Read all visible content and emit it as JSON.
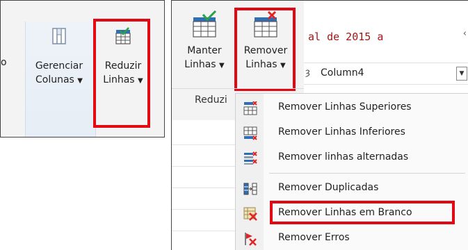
{
  "left": {
    "cut_text": "o",
    "gerenciar": {
      "line1": "Gerenciar",
      "line2": "Colunas"
    },
    "reduzir": {
      "line1": "Reduzir",
      "line2": "Linhas"
    }
  },
  "ribbon": {
    "manter": {
      "line1": "Manter",
      "line2": "Linhas"
    },
    "remover": {
      "line1": "Remover",
      "line2": "Linhas"
    },
    "group_label": "Reduzi"
  },
  "formula_text": "al de 2015 a",
  "formula_right": "‹",
  "column": {
    "type_label": "ȝ",
    "name": "Column4"
  },
  "menu": {
    "items": [
      {
        "label": "Remover Linhas Superiores",
        "icon": "remove-top-rows-icon"
      },
      {
        "label": "Remover Linhas Inferiores",
        "icon": "remove-bottom-rows-icon"
      },
      {
        "label": "Remover linhas alternadas",
        "icon": "remove-alternate-rows-icon"
      },
      {
        "label": "Remover Duplicadas",
        "icon": "remove-duplicates-icon"
      },
      {
        "label": "Remover Linhas em Branco",
        "icon": "remove-blank-rows-icon"
      },
      {
        "label": "Remover Erros",
        "icon": "remove-errors-icon"
      }
    ]
  },
  "colors": {
    "highlight": "#e30613",
    "check": "#2aa248",
    "cross": "#e02424",
    "icon_blue": "#2f6db5"
  }
}
